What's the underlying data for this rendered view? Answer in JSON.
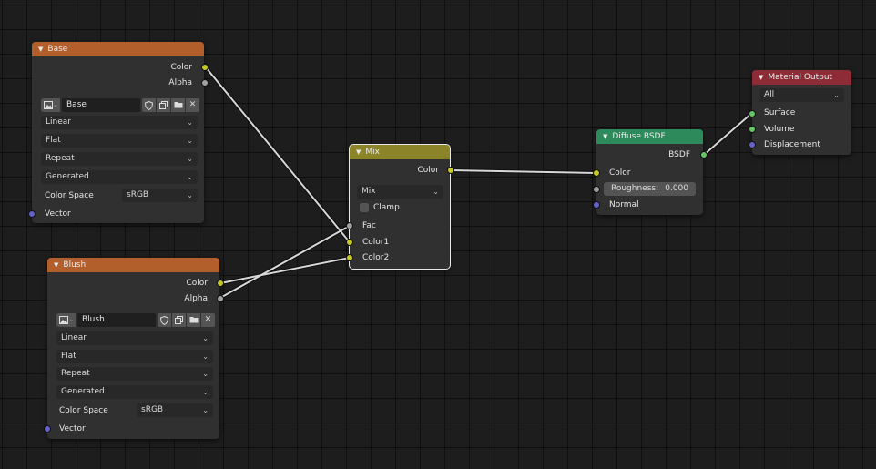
{
  "nodes": {
    "base": {
      "title": "Base",
      "outputs": {
        "color": "Color",
        "alpha": "Alpha"
      },
      "image_name": "Base",
      "interpolation": "Linear",
      "projection": "Flat",
      "extension": "Repeat",
      "source": "Generated",
      "color_space_label": "Color Space",
      "color_space_value": "sRGB",
      "input_vector": "Vector"
    },
    "blush": {
      "title": "Blush",
      "outputs": {
        "color": "Color",
        "alpha": "Alpha"
      },
      "image_name": "Blush",
      "interpolation": "Linear",
      "projection": "Flat",
      "extension": "Repeat",
      "source": "Generated",
      "color_space_label": "Color Space",
      "color_space_value": "sRGB",
      "input_vector": "Vector"
    },
    "mix": {
      "title": "Mix",
      "output_color": "Color",
      "blend_type": "Mix",
      "clamp_label": "Clamp",
      "inputs": {
        "fac": "Fac",
        "color1": "Color1",
        "color2": "Color2"
      }
    },
    "diffuse": {
      "title": "Diffuse BSDF",
      "output": "BSDF",
      "inputs": {
        "color": "Color",
        "normal": "Normal"
      },
      "roughness_label": "Roughness:",
      "roughness_value": "0.000"
    },
    "material_output": {
      "title": "Material Output",
      "target": "All",
      "inputs": {
        "surface": "Surface",
        "volume": "Volume",
        "displacement": "Displacement"
      }
    }
  },
  "colors": {
    "texture_header": "#b25f2c",
    "mix_header": "#8b8429",
    "shader_header": "#2d8a5b",
    "output_header": "#8d2b36",
    "socket_color": "#c7c729",
    "socket_float": "#a1a1a1",
    "socket_vector": "#6363c7",
    "socket_shader": "#63c763",
    "wire": "#d8d8d8",
    "background": "#1d1d1d"
  },
  "icons": {
    "collapse": "triangle-down-icon",
    "image_type": "image-icon",
    "fake_user": "shield-icon",
    "duplicate": "duplicate-icon",
    "open": "folder-icon",
    "unlink": "close-icon",
    "dropdown": "chevron-down-icon"
  }
}
